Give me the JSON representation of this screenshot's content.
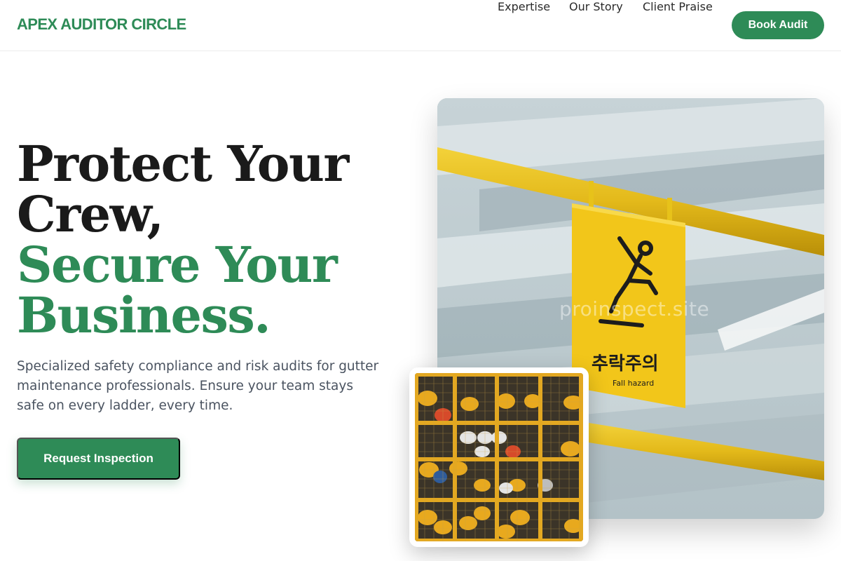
{
  "brand": {
    "name": "APEX AUDITOR CIRCLE",
    "accent": "#2e8b57"
  },
  "nav": {
    "links": [
      {
        "label": "Expertise"
      },
      {
        "label": "Our Story"
      },
      {
        "label": "Client Praise"
      }
    ],
    "cta_label": "Book Audit"
  },
  "hero": {
    "headline_dark": [
      "Protect Your",
      "Crew,"
    ],
    "headline_green": [
      "Secure Your",
      "Business."
    ],
    "subtext": "Specialized safety compliance and risk audits for gutter maintenance professionals. Ensure your team stays safe on every ladder, every time.",
    "cta_label": "Request Inspection"
  },
  "images": {
    "main_photo": {
      "sign_text_korean": "추락주의",
      "sign_text_english": "Fall hazard",
      "watermark": "proinspect.site"
    },
    "secondary_photo": {
      "subject": "hard hats in yellow cage"
    }
  }
}
